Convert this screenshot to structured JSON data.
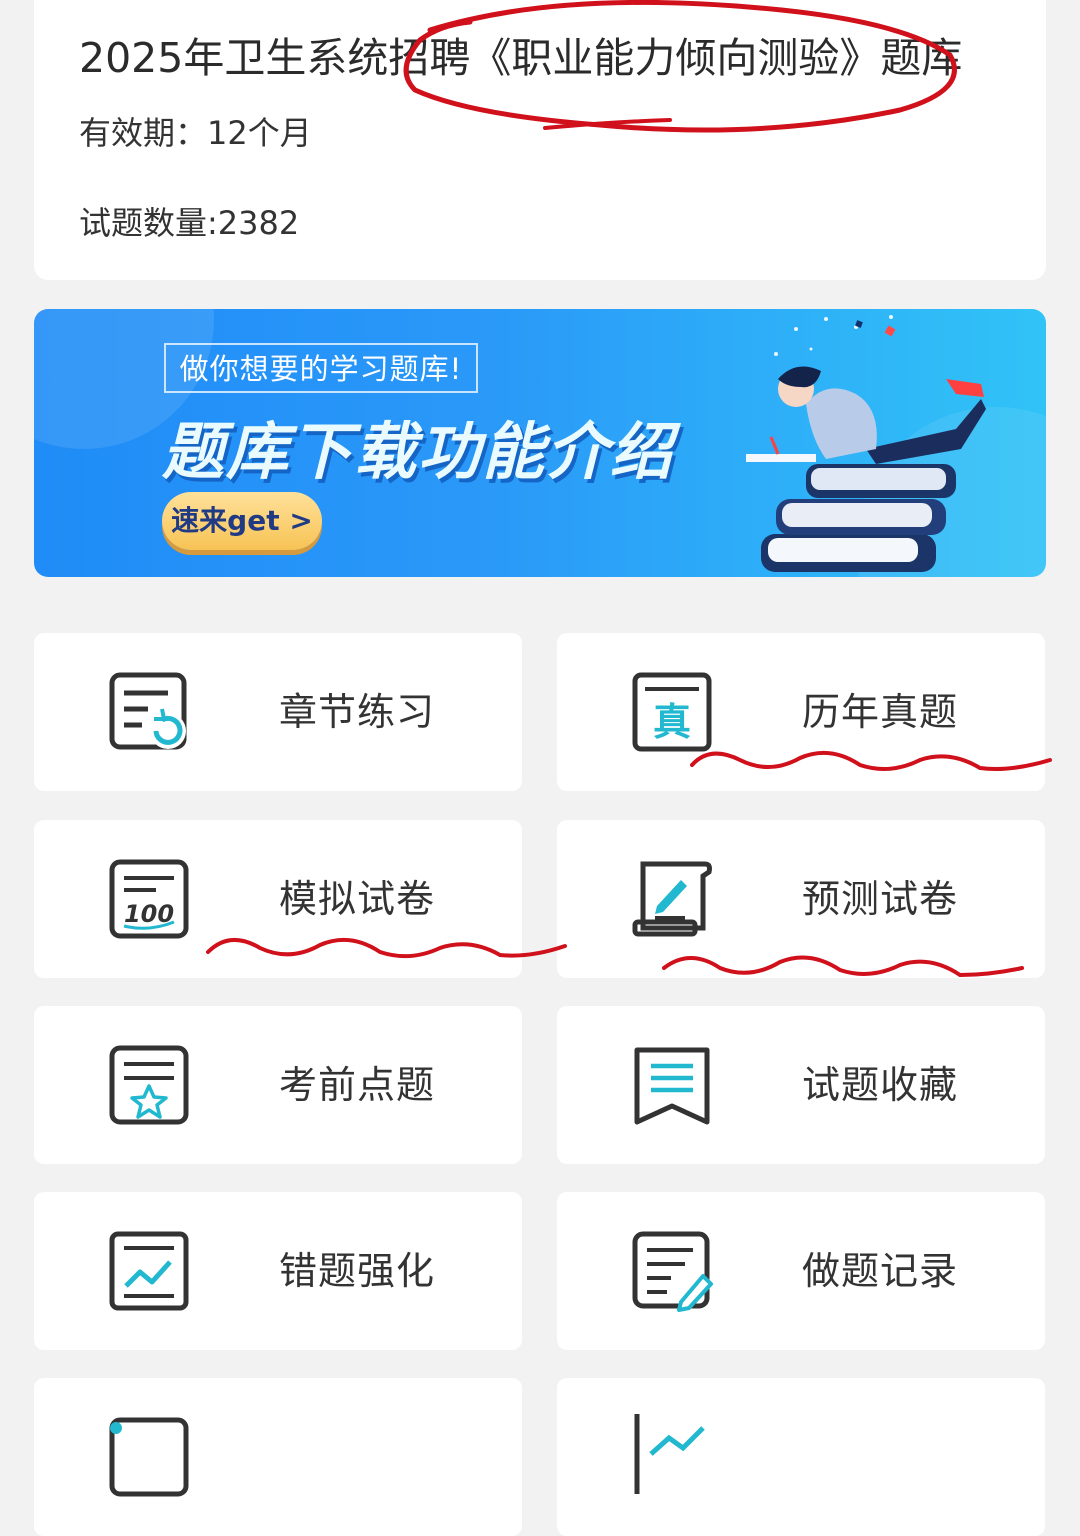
{
  "info": {
    "title": "2025年卫生系统招聘《职业能力倾向测验》题库",
    "validity": "有效期：12个月",
    "question_count": "试题数量:2382"
  },
  "banner": {
    "tag": "做你想要的学习题库!",
    "headline": "题库下载功能介绍",
    "cta": "速来get >"
  },
  "tiles": [
    {
      "label": "章节练习",
      "icon": "chapter-practice-icon"
    },
    {
      "label": "历年真题",
      "icon": "past-exams-icon",
      "badge": "真"
    },
    {
      "label": "模拟试卷",
      "icon": "mock-exam-icon",
      "badge": "100"
    },
    {
      "label": "预测试卷",
      "icon": "forecast-exam-icon"
    },
    {
      "label": "考前点题",
      "icon": "pre-exam-tips-icon"
    },
    {
      "label": "试题收藏",
      "icon": "favorites-icon"
    },
    {
      "label": "错题强化",
      "icon": "wrong-questions-icon"
    },
    {
      "label": "做题记录",
      "icon": "practice-record-icon"
    },
    {
      "label": "",
      "icon": "list-icon"
    },
    {
      "label": "",
      "icon": "chart-icon"
    }
  ],
  "colors": {
    "accent": "#22b8cf",
    "annotation": "#d0101a",
    "banner_blue": "#1f8cf7"
  }
}
